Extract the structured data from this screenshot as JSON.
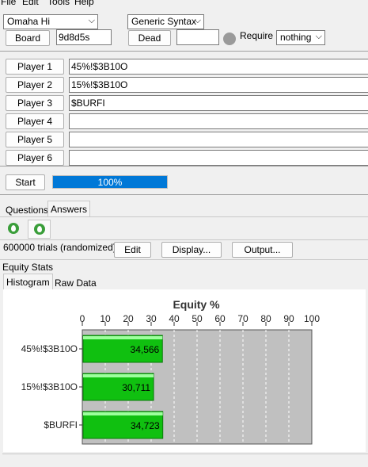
{
  "menu": {
    "file": "File",
    "edit": "Edit",
    "tools": "Tools",
    "help": "Help"
  },
  "game_select": "Omaha Hi",
  "syntax_select": "Generic Syntax",
  "board_button": "Board",
  "board_value": "9d8d5s",
  "dead_button": "Dead",
  "dead_value": "",
  "require_label": "Require",
  "require_select": "nothing",
  "players": [
    {
      "label": "Player 1",
      "value": "45%!$3B10O"
    },
    {
      "label": "Player 2",
      "value": "15%!$3B10O"
    },
    {
      "label": "Player 3",
      "value": "$BURFI"
    },
    {
      "label": "Player 4",
      "value": ""
    },
    {
      "label": "Player 5",
      "value": ""
    },
    {
      "label": "Player 6",
      "value": ""
    }
  ],
  "start_button": "Start",
  "progress": {
    "percent": 100,
    "label": "100%"
  },
  "tabs": {
    "questions": "Questions",
    "answers": "Answers"
  },
  "trials_text": "600000 trials (randomized)",
  "edit_button": "Edit",
  "display_button": "Display...",
  "output_button": "Output...",
  "equity_stats_label": "Equity Stats",
  "subtabs": {
    "histogram": "Histogram",
    "raw_data": "Raw Data"
  },
  "colors": {
    "bar": "#10c010",
    "bar_edge": "#0a7a0a",
    "plot_bg": "#c0c0c0",
    "progress": "#0078d7"
  },
  "chart_data": {
    "type": "bar",
    "orientation": "horizontal",
    "title": "Equity %",
    "xlim": [
      0,
      100
    ],
    "ticks": [
      0,
      10,
      20,
      30,
      40,
      50,
      60,
      70,
      80,
      90,
      100
    ],
    "categories": [
      "45%!$3B10O",
      "15%!$3B10O",
      "$BURFI"
    ],
    "values": [
      34.566,
      30.711,
      34.723
    ],
    "value_labels": [
      "34,566",
      "30,711",
      "34,723"
    ]
  }
}
